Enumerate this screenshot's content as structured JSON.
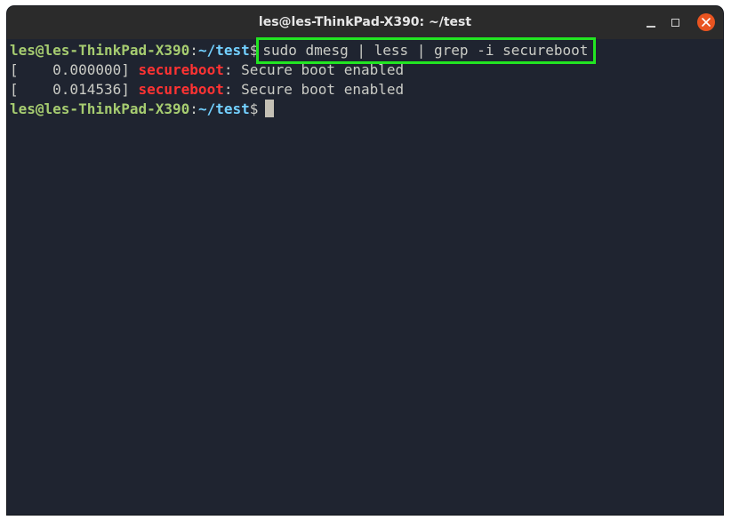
{
  "window": {
    "title": "les@les-ThinkPad-X390: ~/test"
  },
  "colors": {
    "background": "#1f2430",
    "prompt_user": "#a6cc70",
    "prompt_path": "#73d0ff",
    "highlight_match": "#ff3333",
    "annotation_box": "#22e522",
    "close_button": "#e95420"
  },
  "terminal": {
    "prompt": {
      "user_host": "les@les-ThinkPad-X390",
      "colon": ":",
      "path": "~/test",
      "symbol": "$"
    },
    "command": "sudo dmesg | less | grep -i secureboot",
    "output": [
      {
        "timestamp": "[    0.000000]",
        "match": "secureboot",
        "rest": ": Secure boot enabled"
      },
      {
        "timestamp": "[    0.014536]",
        "match": "secureboot",
        "rest": ": Secure boot enabled"
      }
    ]
  }
}
